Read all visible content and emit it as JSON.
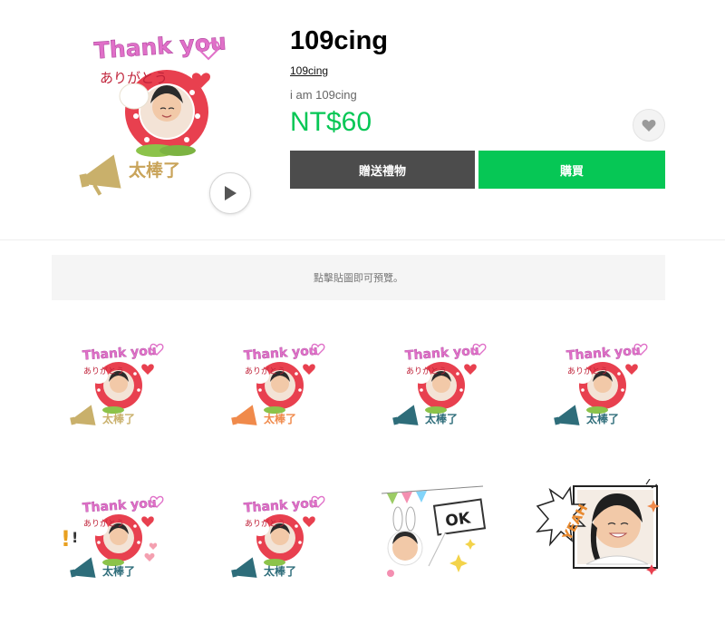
{
  "product": {
    "title": "109cing",
    "author": "109cing",
    "description": "i am 109cing",
    "price": "NT$60"
  },
  "actions": {
    "gift_label": "贈送禮物",
    "buy_label": "購買"
  },
  "preview_notice": "點擊貼圖即可預覽。",
  "sticker_text": {
    "thank_you": "Thank you",
    "arigatou": "ありがとう",
    "great_job": "太棒了",
    "ok": "OK",
    "yeah": "YEAH"
  },
  "stickers": [
    {
      "style": "thanks",
      "horn_color": "#c9b06b"
    },
    {
      "style": "thanks",
      "horn_color": "#f08a4b"
    },
    {
      "style": "thanks",
      "horn_color": "#2e6d7a"
    },
    {
      "style": "thanks",
      "horn_color": "#2e6d7a"
    },
    {
      "style": "thanks-exclaim",
      "horn_color": "#2e6d7a"
    },
    {
      "style": "thanks",
      "horn_color": "#2e6d7a"
    },
    {
      "style": "ok-sign"
    },
    {
      "style": "yeah-photo"
    }
  ],
  "colors": {
    "accent_green": "#06c755",
    "gift_button": "#4c4c4c",
    "thank_pink": "#e070c8",
    "ring_red": "#e8404f",
    "text_gold": "#c9a45a"
  },
  "icons": {
    "play": "play-icon",
    "favorite": "heart-icon",
    "megaphone": "megaphone-icon"
  }
}
